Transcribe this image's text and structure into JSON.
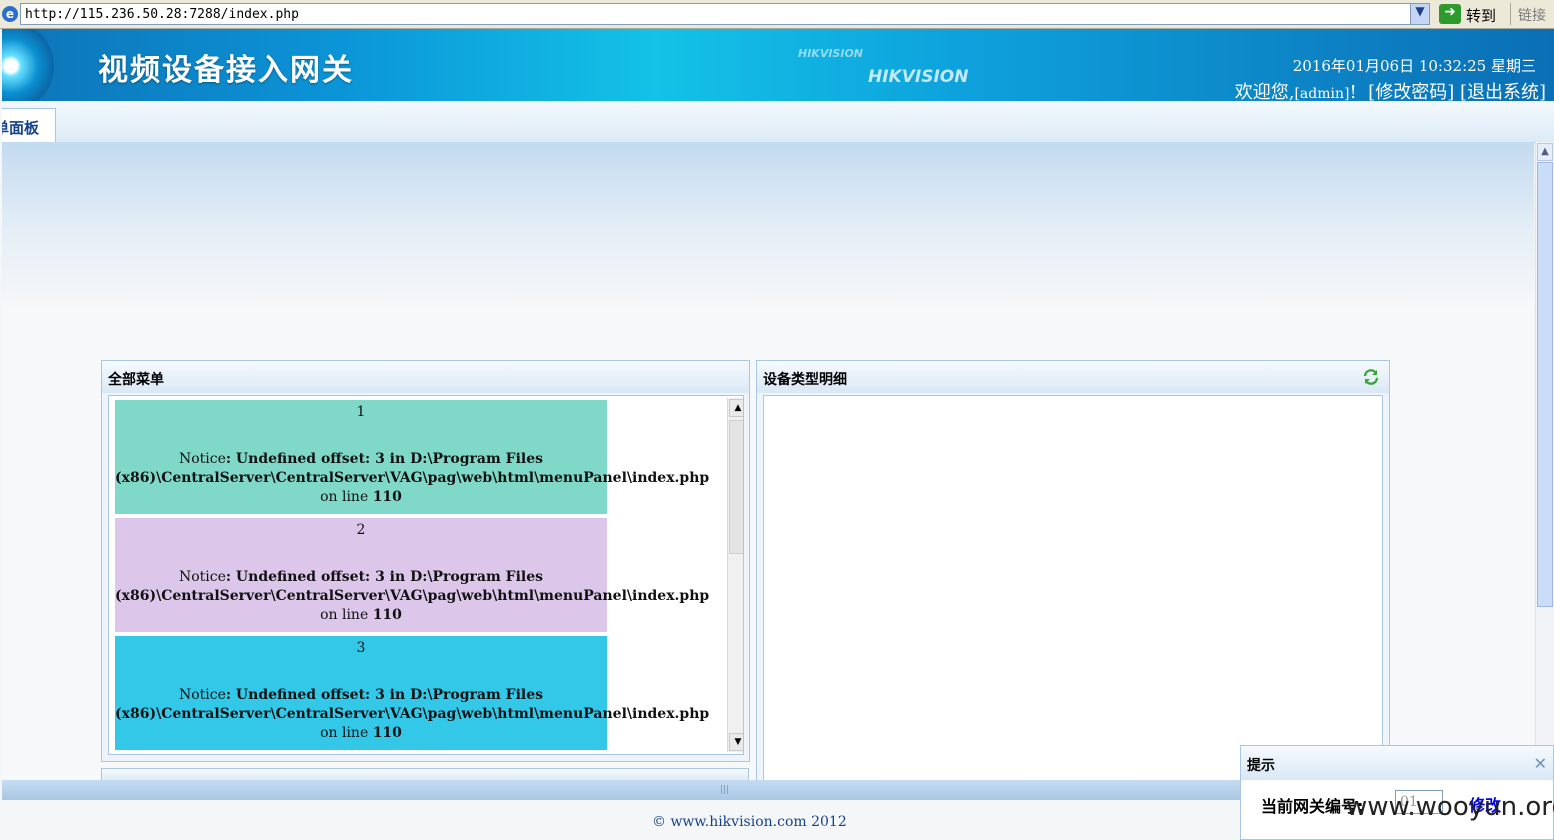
{
  "browser": {
    "url": "http://115.236.50.28:7288/index.php",
    "go_label": "转到",
    "links_label": "链接"
  },
  "header": {
    "title": "视频设备接入网关",
    "brand_small": "HIKVISION",
    "brand": "HIKVISION",
    "datetime": "2016年01月06日 10:32:25 星期三",
    "welcome_prefix": "欢迎您,",
    "username": "[admin]",
    "welcome_suffix": "!",
    "change_password": "[修改密码]",
    "logout": "[退出系统]"
  },
  "tabs": [
    {
      "label": "单面板",
      "active": true
    }
  ],
  "panels": {
    "menu": {
      "title": "全部菜单",
      "items": [
        {
          "number": "1",
          "notice_prefix": "Notice",
          "notice_message": ": Undefined offset: 3 in ",
          "file_path": "D:\\Program Files (x86)\\CentralServer\\CentralServer\\VAG\\pag\\web\\html\\menuPanel\\index.php",
          "line_text": " on line ",
          "line_number": "110",
          "color": "#80d8c8"
        },
        {
          "number": "2",
          "notice_prefix": "Notice",
          "notice_message": ": Undefined offset: 3 in ",
          "file_path": "D:\\Program Files (x86)\\CentralServer\\CentralServer\\VAG\\pag\\web\\html\\menuPanel\\index.php",
          "line_text": " on line ",
          "line_number": "110",
          "color": "#dcc6ea"
        },
        {
          "number": "3",
          "notice_prefix": "Notice",
          "notice_message": ": Undefined offset: 3 in ",
          "file_path": "D:\\Program Files (x86)\\CentralServer\\CentralServer\\VAG\\pag\\web\\html\\menuPanel\\index.php",
          "line_text": " on line ",
          "line_number": "110",
          "color": "#33c8e8"
        }
      ]
    },
    "device_types": {
      "title": "设备类型明细",
      "refresh_icon": "refresh-icon"
    }
  },
  "footer": {
    "copyright": "© www.hikvision.com   2012"
  },
  "tip": {
    "title": "提示",
    "gateway_label": "当前网关编号:",
    "gateway_value": "01",
    "modify_label": "修改",
    "close_icon": "close-icon"
  },
  "watermark": "www.wooyun.org"
}
